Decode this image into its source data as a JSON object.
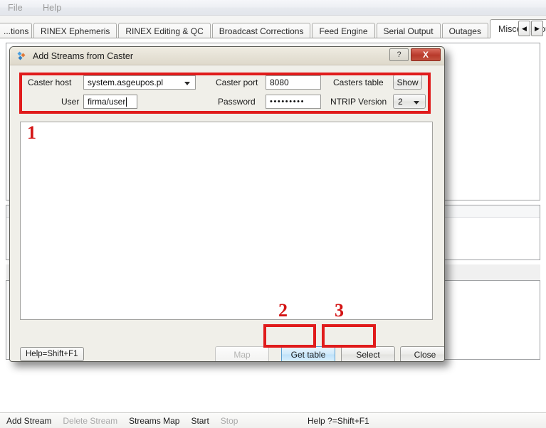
{
  "menubar": {
    "items": [
      {
        "label": "File"
      },
      {
        "label": "Help"
      }
    ]
  },
  "tabs": {
    "items": [
      {
        "label": "...tions",
        "active": false
      },
      {
        "label": "RINEX Ephemeris",
        "active": false
      },
      {
        "label": "RINEX Editing & QC",
        "active": false
      },
      {
        "label": "Broadcast Corrections",
        "active": false
      },
      {
        "label": "Feed Engine",
        "active": false
      },
      {
        "label": "Serial Output",
        "active": false
      },
      {
        "label": "Outages",
        "active": false
      },
      {
        "label": "Miscellaneous",
        "active": true
      }
    ],
    "scroll_left_icon": "triangle-left-icon",
    "scroll_right_icon": "triangle-right-icon"
  },
  "dialog": {
    "title": "Add Streams from Caster",
    "icon": "caster-streams-icon",
    "help_button_label": "?",
    "close_button_label": "X",
    "form": {
      "caster_host": {
        "label": "Caster host",
        "value": "system.asgeupos.pl",
        "dropdown_icon": "chevron-down-icon"
      },
      "caster_port": {
        "label": "Caster port",
        "value": "8080"
      },
      "casters_table": {
        "label": "Casters table",
        "button_label": "Show"
      },
      "user": {
        "label": "User",
        "value": "firma/user"
      },
      "password": {
        "label": "Password",
        "value": "•••••••••"
      },
      "ntrip_version": {
        "label": "NTRIP Version",
        "value": "2",
        "dropdown_icon": "chevron-down-icon"
      }
    },
    "stream_list": {
      "rows": []
    },
    "footer": {
      "help_hint": "Help=Shift+F1",
      "map_label": "Map",
      "get_table_label": "Get table",
      "select_label": "Select",
      "close_label": "Close"
    }
  },
  "annotations": {
    "boxes": [
      {
        "number": "1",
        "target": "credentials-form"
      },
      {
        "number": "2",
        "target": "get-table-button"
      },
      {
        "number": "3",
        "target": "select-button"
      }
    ],
    "color": "#e01b1b"
  },
  "statusbar": {
    "items": [
      {
        "label": "Add Stream",
        "enabled": true
      },
      {
        "label": "Delete Stream",
        "enabled": false
      },
      {
        "label": "Streams Map",
        "enabled": true
      },
      {
        "label": "Start",
        "enabled": true
      },
      {
        "label": "Stop",
        "enabled": false
      }
    ],
    "help": "Help ?=Shift+F1"
  }
}
